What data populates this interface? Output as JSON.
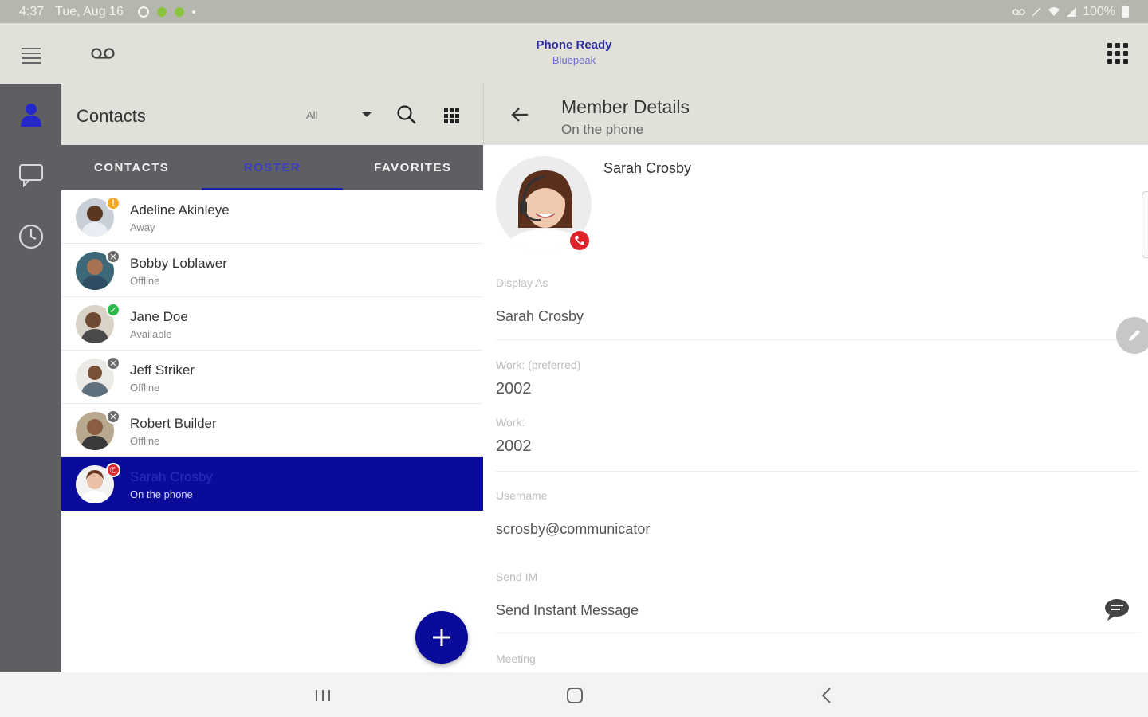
{
  "status_bar": {
    "time": "4:37",
    "date": "Tue, Aug 16",
    "battery": "100%"
  },
  "app_bar": {
    "title": "Phone Ready",
    "subtitle": "Bluepeak",
    "icons": [
      "hamburger-menu-icon",
      "voicemail-icon",
      "dialpad-icon"
    ]
  },
  "rail": {
    "items": [
      {
        "icon": "person-icon",
        "active": true
      },
      {
        "icon": "chat-icon",
        "active": false
      },
      {
        "icon": "clock-icon",
        "active": false
      }
    ]
  },
  "contacts": {
    "title": "Contacts",
    "filter": "All",
    "tabs": [
      {
        "label": "CONTACTS",
        "active": false
      },
      {
        "label": "ROSTER",
        "active": true
      },
      {
        "label": "FAVORITES",
        "active": false
      }
    ],
    "rows": [
      {
        "name": "Adeline Akinleye",
        "status": "Away",
        "badge": "away",
        "selected": false
      },
      {
        "name": "Bobby Loblawer",
        "status": "Offline",
        "badge": "offline",
        "selected": false
      },
      {
        "name": "Jane Doe",
        "status": "Available",
        "badge": "available",
        "selected": false
      },
      {
        "name": "Jeff Striker",
        "status": "Offline",
        "badge": "offline",
        "selected": false
      },
      {
        "name": "Robert Builder",
        "status": "Offline",
        "badge": "offline",
        "selected": false
      },
      {
        "name": "Sarah Crosby",
        "status": "On the phone",
        "badge": "on-phone",
        "selected": true
      }
    ]
  },
  "detail": {
    "title": "Member Details",
    "subtitle": "On the phone",
    "name": "Sarah Crosby",
    "fields": {
      "display_as_label": "Display As",
      "display_as_value": "Sarah Crosby",
      "work_preferred_label": "Work: (preferred)",
      "work_preferred_value": "2002",
      "work_label": "Work:",
      "work_value": "2002",
      "username_label": "Username",
      "username_value": "scrosby@communicator",
      "send_im_label": "Send IM",
      "send_im_value": "Send Instant Message",
      "meeting_label": "Meeting"
    }
  },
  "colors": {
    "primary": "#0a0a9b",
    "header_bg": "#e1e1da",
    "rail_bg": "#5d5f62",
    "away": "#f5a623",
    "available": "#2db84c",
    "on_phone": "#e0222a",
    "offline": "#6b6b6b"
  }
}
